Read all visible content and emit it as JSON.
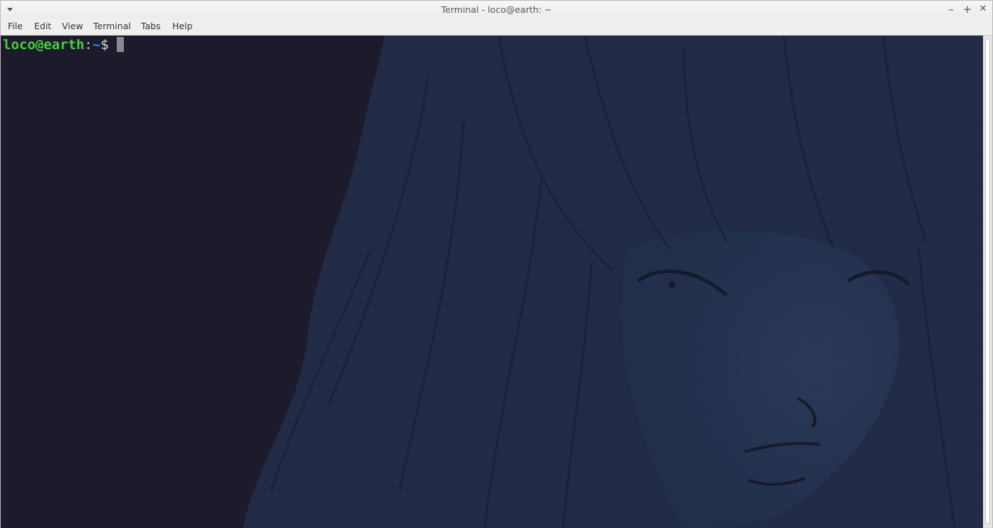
{
  "window": {
    "title": "Terminal - loco@earth: ~",
    "controls": {
      "minimize": "–",
      "maximize": "+",
      "close": "✕"
    }
  },
  "menubar": {
    "items": [
      "File",
      "Edit",
      "View",
      "Terminal",
      "Tabs",
      "Help"
    ]
  },
  "terminal": {
    "prompt_user_host": "loco@earth",
    "prompt_separator": ":",
    "prompt_path": "~",
    "prompt_symbol": "$",
    "background_color": "#1d1b2c",
    "user_color": "#44d23a",
    "path_color": "#3c7be0"
  }
}
